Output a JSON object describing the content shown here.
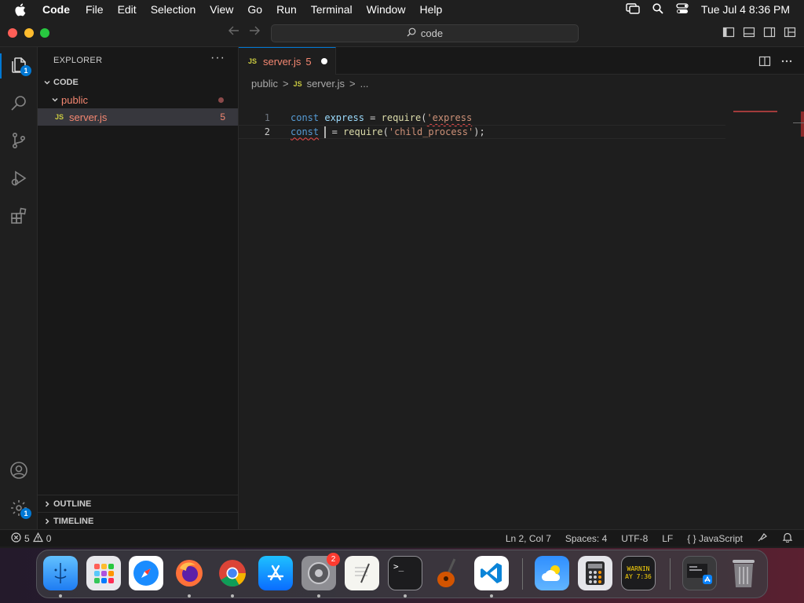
{
  "menubar": {
    "app_name": "Code",
    "items": [
      "File",
      "Edit",
      "Selection",
      "View",
      "Go",
      "Run",
      "Terminal",
      "Window",
      "Help"
    ],
    "clock": "Tue Jul 4  8:36 PM"
  },
  "titlebar": {
    "search_text": "code"
  },
  "activitybar": {
    "explorer_badge": "1",
    "settings_badge": "1"
  },
  "sidebar": {
    "header": "EXPLORER",
    "more": "···",
    "root_folder": "CODE",
    "folder": "public",
    "file": {
      "icon": "JS",
      "name": "server.js",
      "problems": "5"
    },
    "outline_label": "OUTLINE",
    "timeline_label": "TIMELINE"
  },
  "editor": {
    "tab": {
      "icon": "JS",
      "name": "server.js",
      "problems": "5"
    },
    "breadcrumb": {
      "folder": "public",
      "sep": ">",
      "icon": "JS",
      "file": "server.js",
      "ellipsis": "..."
    },
    "lines": [
      {
        "num": "1",
        "kw": "const",
        "ident": "express",
        "op": " = ",
        "fn": "require",
        "paren": "(",
        "str": "'express"
      },
      {
        "num": "2",
        "kw": "const",
        "op": " = ",
        "fn": "require",
        "paren": "(",
        "str": "'child_process'",
        "end": ");"
      }
    ]
  },
  "statusbar": {
    "errors": "5",
    "warnings": "0",
    "position": "Ln 2, Col 7",
    "spaces": "Spaces: 4",
    "encoding": "UTF-8",
    "eol": "LF",
    "language_braces": "{ }",
    "language": "JavaScript"
  },
  "dock": {
    "settings_badge": "2",
    "console_text": "WARNIN\nAY 7:36",
    "terminal_prompt": ">_"
  },
  "colors": {
    "accent": "#0078d4",
    "error": "#f48771",
    "keyword": "#569cd6"
  }
}
